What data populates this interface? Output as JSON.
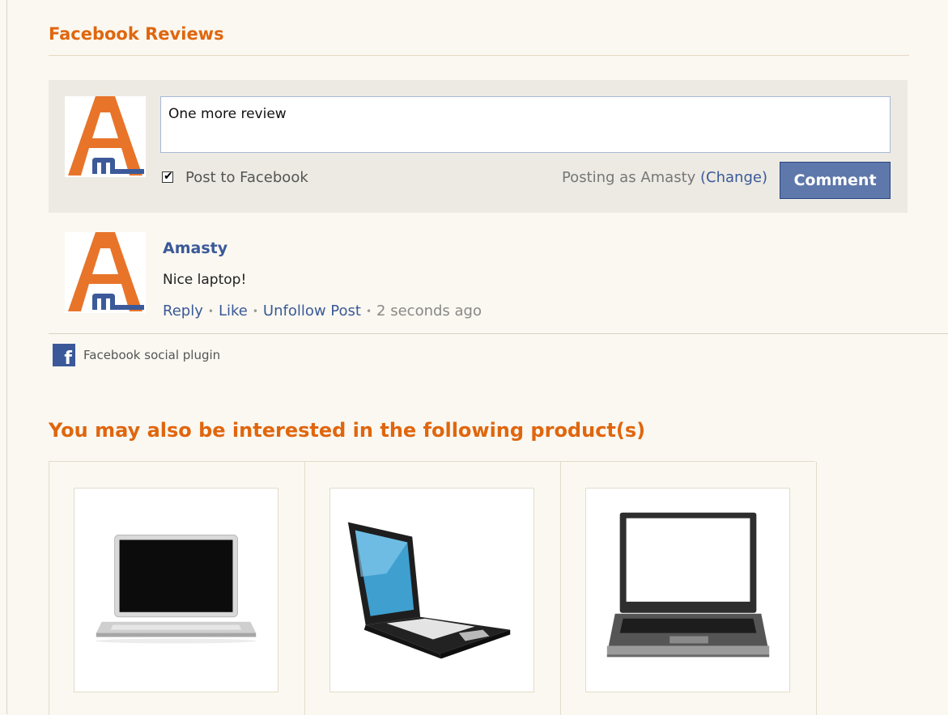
{
  "reviews": {
    "title": "Facebook Reviews",
    "composer": {
      "text": "One more review",
      "post_to_facebook_label": "Post to Facebook",
      "post_to_facebook_checked": true,
      "posting_as_prefix": "Posting as Amasty",
      "change_link": "(Change)",
      "comment_button": "Comment"
    },
    "comment": {
      "author": "Amasty",
      "message": "Nice laptop!",
      "actions": [
        "Reply",
        "Like",
        "Unfollow Post"
      ],
      "time": "2 seconds ago"
    },
    "plugin_label": "Facebook social plugin"
  },
  "related": {
    "title": "You may also be interested in the following product(s)",
    "products": [
      {
        "image": "silver-laptop-image"
      },
      {
        "image": "black-laptop-image"
      },
      {
        "image": "gray-laptop-image"
      }
    ]
  },
  "colors": {
    "heading": "#e0660e",
    "link": "#3b5998",
    "button": "#5f78ab",
    "logo_orange": "#e8742a",
    "logo_blue": "#3c5a99"
  }
}
